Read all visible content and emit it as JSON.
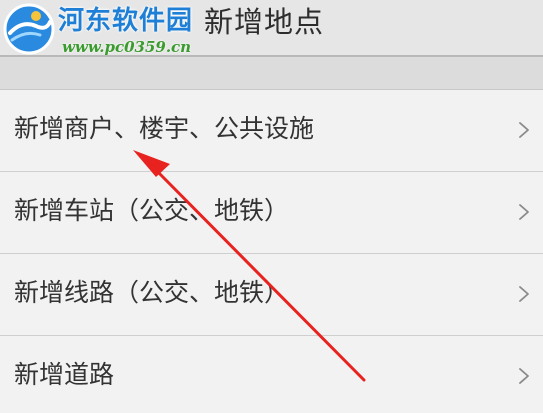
{
  "header": {
    "title": "新增地点",
    "back_icon": "chevron-left-icon"
  },
  "watermark": {
    "name": "河东软件园",
    "url": "www.pc0359.cn"
  },
  "list": {
    "items": [
      {
        "label": "新增商户、楼宇、公共设施",
        "icon": "chevron-right-icon"
      },
      {
        "label": "新增车站（公交、地铁）",
        "icon": "chevron-right-icon"
      },
      {
        "label": "新增线路（公交、地铁）",
        "icon": "chevron-right-icon"
      },
      {
        "label": "新增道路",
        "icon": "chevron-right-icon"
      }
    ]
  },
  "colors": {
    "background": "#f0f0f0",
    "header_bg": "#e6e6e6",
    "text": "#333333",
    "chevron": "#8a8a8a",
    "annotation_arrow": "#e8231f",
    "watermark_blue": "#1e7fd6",
    "watermark_green": "#3a9b2e"
  }
}
